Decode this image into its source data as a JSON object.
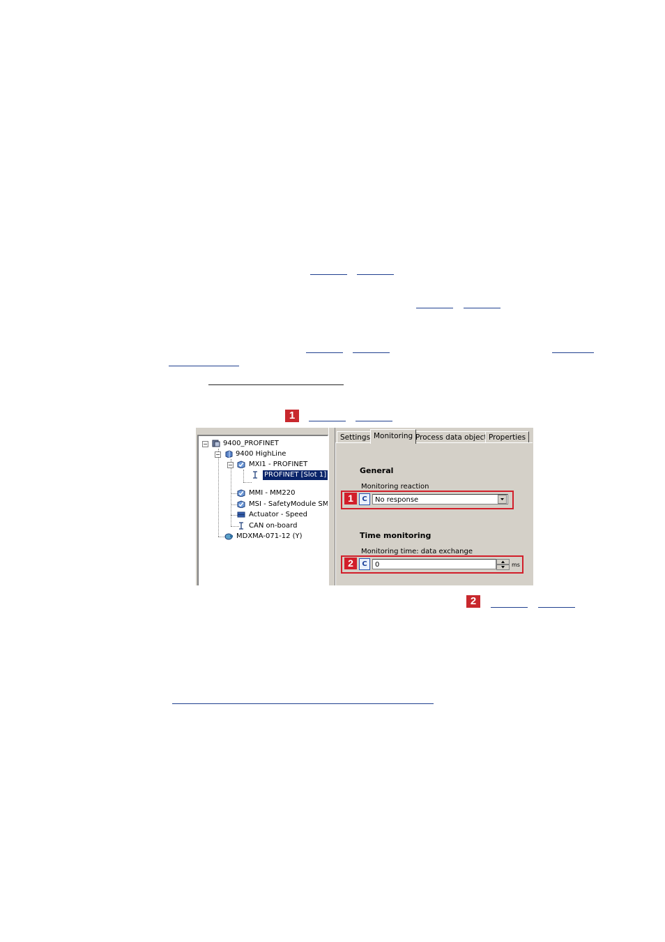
{
  "figure": {
    "badge_1": "1",
    "badge_2": "2"
  },
  "screenshot": {
    "tree": {
      "items": [
        {
          "label": "9400_PROFINET"
        },
        {
          "label": "9400 HighLine"
        },
        {
          "label": "MXI1 - PROFINET"
        },
        {
          "label": "PROFINET [Slot 1]",
          "selected": true
        },
        {
          "label": "MMI - MM220"
        },
        {
          "label": "MSI - SafetyModule SM"
        },
        {
          "label": "Actuator - Speed"
        },
        {
          "label": "CAN on-board"
        },
        {
          "label": "MDXMA-071-12 (Y)"
        }
      ]
    },
    "tabs": [
      {
        "label": "Settings"
      },
      {
        "label": "Monitoring",
        "active": true
      },
      {
        "label": "Process data objects"
      },
      {
        "label": "Properties"
      }
    ],
    "general": {
      "title": "General",
      "reaction_label": "Monitoring reaction",
      "marker": "1",
      "c_button": "C",
      "reaction_value": "No response"
    },
    "time": {
      "title": "Time monitoring",
      "time_label": "Monitoring time: data exchange",
      "marker": "2",
      "c_button": "C",
      "time_value": "0",
      "unit": "ms"
    },
    "colors": {
      "marker_red": "#d21e2a",
      "selection_blue": "#0a246a",
      "link_blue": "#1f3f8f"
    }
  }
}
